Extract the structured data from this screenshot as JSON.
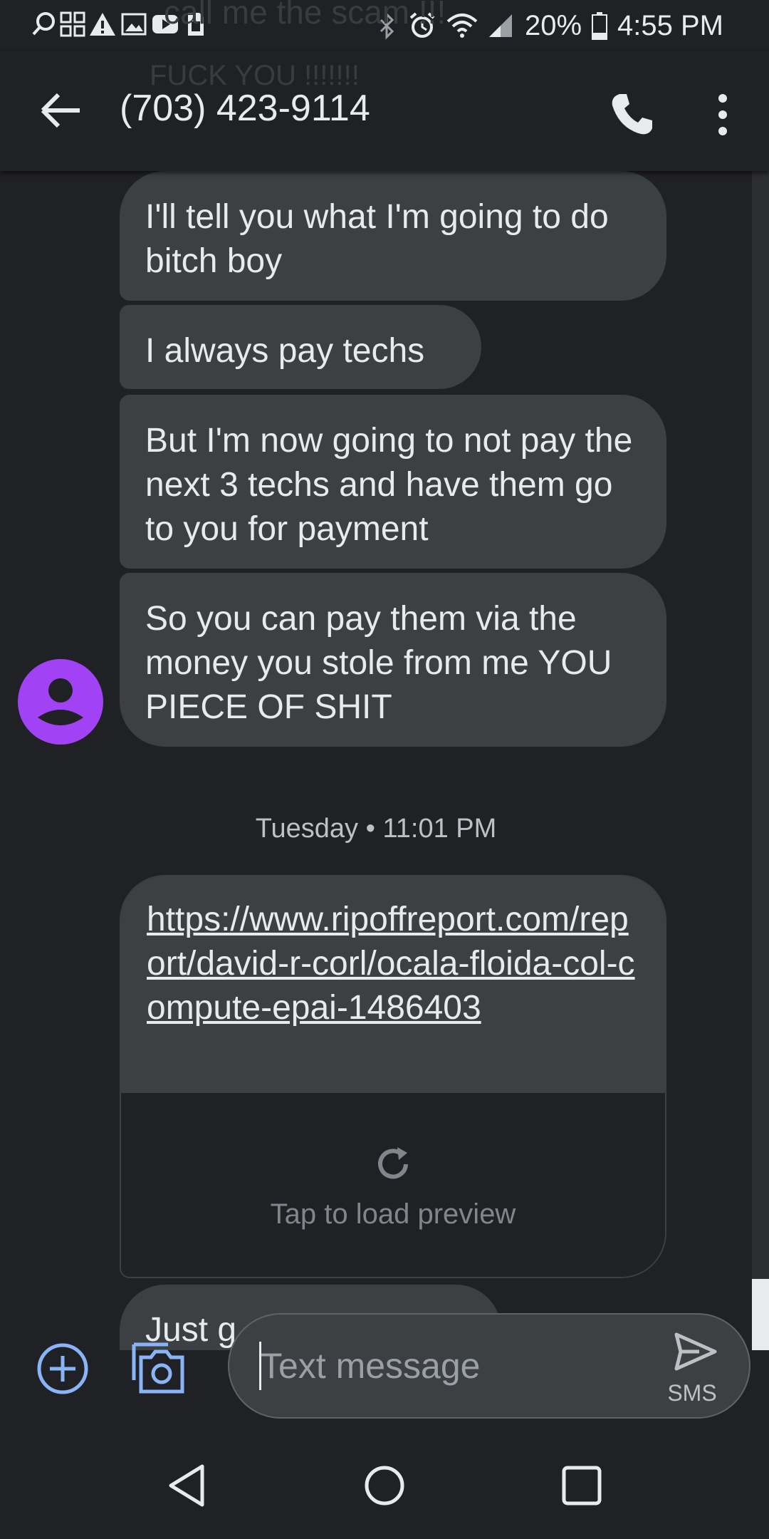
{
  "status_bar": {
    "battery": "20%",
    "time": "4:55 PM",
    "icons": [
      "search-icon",
      "apps-grid-icon",
      "warning-icon",
      "image-icon",
      "youtube-icon",
      "sim-icon",
      "bluetooth-icon",
      "alarm-icon",
      "wifi-icon",
      "signal-icon",
      "battery-icon"
    ]
  },
  "app_bar": {
    "title": "(703) 423-9114",
    "faded_notification_1": "call me the scam !!!",
    "faded_notification_2": "FUCK YOU !!!!!!!"
  },
  "messages": [
    {
      "text": "I'll tell you what I'm going to do bitch boy"
    },
    {
      "text": "I always pay techs"
    },
    {
      "text": "But I'm now going to not pay the next 3 techs and have them go to you for payment"
    },
    {
      "text": "So you can pay them via the money you stole from me YOU PIECE OF SHIT"
    }
  ],
  "timestamp": "Tuesday • 11:01 PM",
  "link_message": {
    "url": "https://www.ripoffreport.com/report/david-r-corl/ocala-floida-col-compute-epai-1486403",
    "preview_label": "Tap to load preview"
  },
  "partial_message": "Just g",
  "compose": {
    "placeholder": "Text message",
    "send_label": "SMS"
  },
  "colors": {
    "background": "#202124",
    "bubble": "#3c4043",
    "avatar": "#a142f4",
    "accent": "#8ab4f8"
  }
}
